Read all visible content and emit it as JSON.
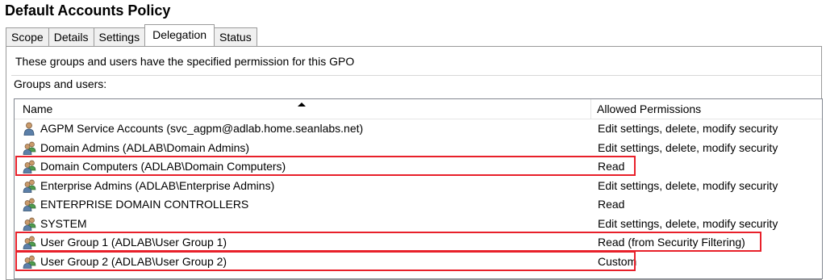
{
  "window": {
    "title": "Default Accounts Policy"
  },
  "tabs": [
    {
      "label": "Scope",
      "active": false
    },
    {
      "label": "Details",
      "active": false
    },
    {
      "label": "Settings",
      "active": false
    },
    {
      "label": "Delegation",
      "active": true
    },
    {
      "label": "Status",
      "active": false
    }
  ],
  "delegation": {
    "intro_text": "These groups and users have the specified permission for this GPO",
    "groups_label": "Groups and users:",
    "columns": {
      "name": "Name",
      "permissions": "Allowed Permissions"
    },
    "rows": [
      {
        "name": "AGPM Service Accounts (svc_agpm@adlab.home.seanlabs.net)",
        "permission": "Edit settings, delete, modify security",
        "icon": "user-icon"
      },
      {
        "name": "Domain Admins (ADLAB\\Domain Admins)",
        "permission": "Edit settings, delete, modify security",
        "icon": "group-icon"
      },
      {
        "name": "Domain Computers (ADLAB\\Domain Computers)",
        "permission": "Read",
        "icon": "group-icon",
        "highlighted": true
      },
      {
        "name": "Enterprise Admins (ADLAB\\Enterprise Admins)",
        "permission": "Edit settings, delete, modify security",
        "icon": "group-icon"
      },
      {
        "name": "ENTERPRISE DOMAIN CONTROLLERS",
        "permission": "Read",
        "icon": "group-icon"
      },
      {
        "name": "SYSTEM",
        "permission": "Edit settings, delete, modify security",
        "icon": "group-icon"
      },
      {
        "name": "User Group 1 (ADLAB\\User Group 1)",
        "permission": "Read (from Security Filtering)",
        "icon": "group-icon",
        "highlighted": true
      },
      {
        "name": "User Group 2 (ADLAB\\User Group 2)",
        "permission": "Custom",
        "icon": "group-icon",
        "highlighted": true
      }
    ]
  },
  "colors": {
    "highlight_border": "#e8202a",
    "tab_border": "#9a9a9a"
  }
}
